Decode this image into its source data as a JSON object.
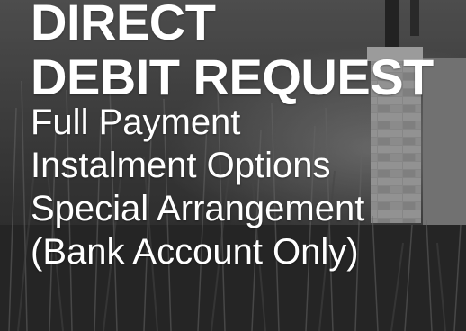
{
  "heading": {
    "line1": "DIRECT",
    "line2": "DEBIT REQUEST"
  },
  "options": [
    "Full Payment",
    "Instalment Options",
    "Special Arrangement",
    "(Bank Account Only)"
  ],
  "colors": {
    "text": "#ffffff",
    "background": "#3c3c3c"
  }
}
